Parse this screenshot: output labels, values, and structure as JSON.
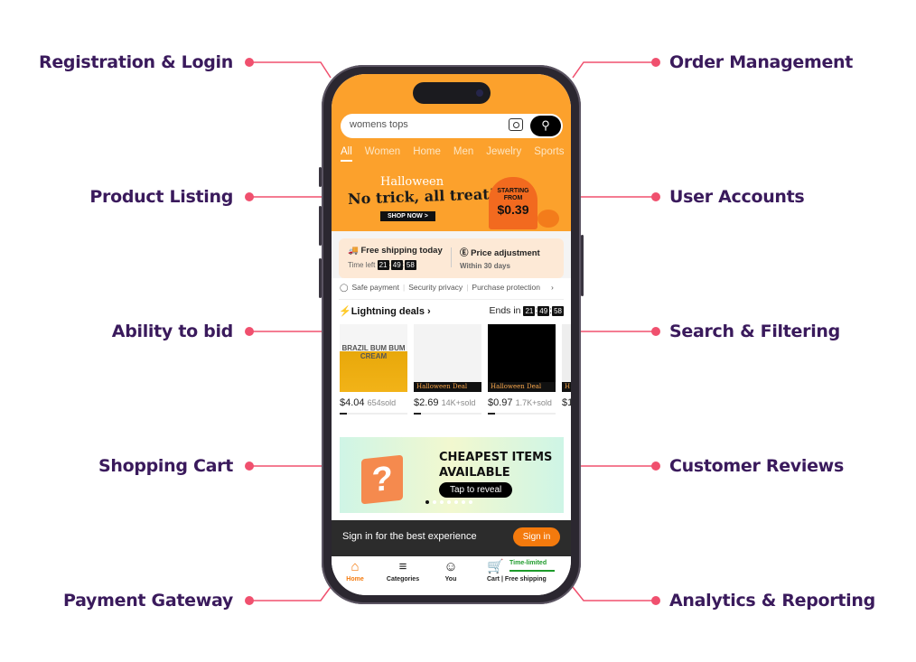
{
  "features_left": [
    "Registration & Login",
    "Product Listing",
    "Ability to bid",
    "Shopping Cart",
    "Payment Gateway"
  ],
  "features_right": [
    "Order Management",
    "User Accounts",
    "Search & Filtering",
    "Customer Reviews",
    "Analytics & Reporting"
  ],
  "colors": {
    "label": "#3a1a5c",
    "connector": "#f0506e",
    "app_orange": "#fca12c",
    "accent": "#f47a0d"
  },
  "app": {
    "search": {
      "value": "womens tops",
      "camera_icon": "camera-icon",
      "search_icon": "search-icon"
    },
    "tabs": [
      "All",
      "Women",
      "Home",
      "Men",
      "Jewelry",
      "Sports"
    ],
    "active_tab": "All",
    "banner": {
      "script": "Halloween",
      "headline": "No trick, all treat!",
      "cta": "SHOP NOW >",
      "starting": "STARTING FROM",
      "price": "$0.39"
    },
    "shipping": {
      "title": "Free shipping today",
      "time_label": "Time left",
      "h": "21",
      "m": "49",
      "s": "58"
    },
    "price_adj": {
      "title": "Price adjustment",
      "sub": "Within 30 days"
    },
    "trust": [
      "Safe payment",
      "Security privacy",
      "Purchase protection"
    ],
    "deals": {
      "title": "Lightning deals",
      "ends_label": "Ends in",
      "h": "21",
      "m": "49",
      "s": "58"
    },
    "products": [
      {
        "image_text": "BRAZIL BUM BUM CREAM",
        "price": "$4.04",
        "sold": "654sold",
        "tag": ""
      },
      {
        "image_text": "",
        "price": "$2.69",
        "sold": "14K+sold",
        "tag": "Halloween Deal"
      },
      {
        "image_text": "",
        "price": "$0.97",
        "sold": "1.7K+sold",
        "tag": "Halloween Deal"
      },
      {
        "image_text": "",
        "price": "$1",
        "sold": "",
        "tag": "H"
      }
    ],
    "promo": {
      "title1": "CHEAPEST ITEMS",
      "title2": "AVAILABLE",
      "cta": "Tap to reveal",
      "box": "?"
    },
    "signin": {
      "text": "Sign in for the best experience",
      "button": "Sign in"
    },
    "nav": [
      {
        "label": "Home",
        "icon": "home-icon"
      },
      {
        "label": "Categories",
        "icon": "categories-search-icon"
      },
      {
        "label": "You",
        "icon": "user-icon"
      },
      {
        "label": "Cart | Free shipping",
        "icon": "cart-icon"
      }
    ],
    "time_limited": "Time-limited"
  }
}
